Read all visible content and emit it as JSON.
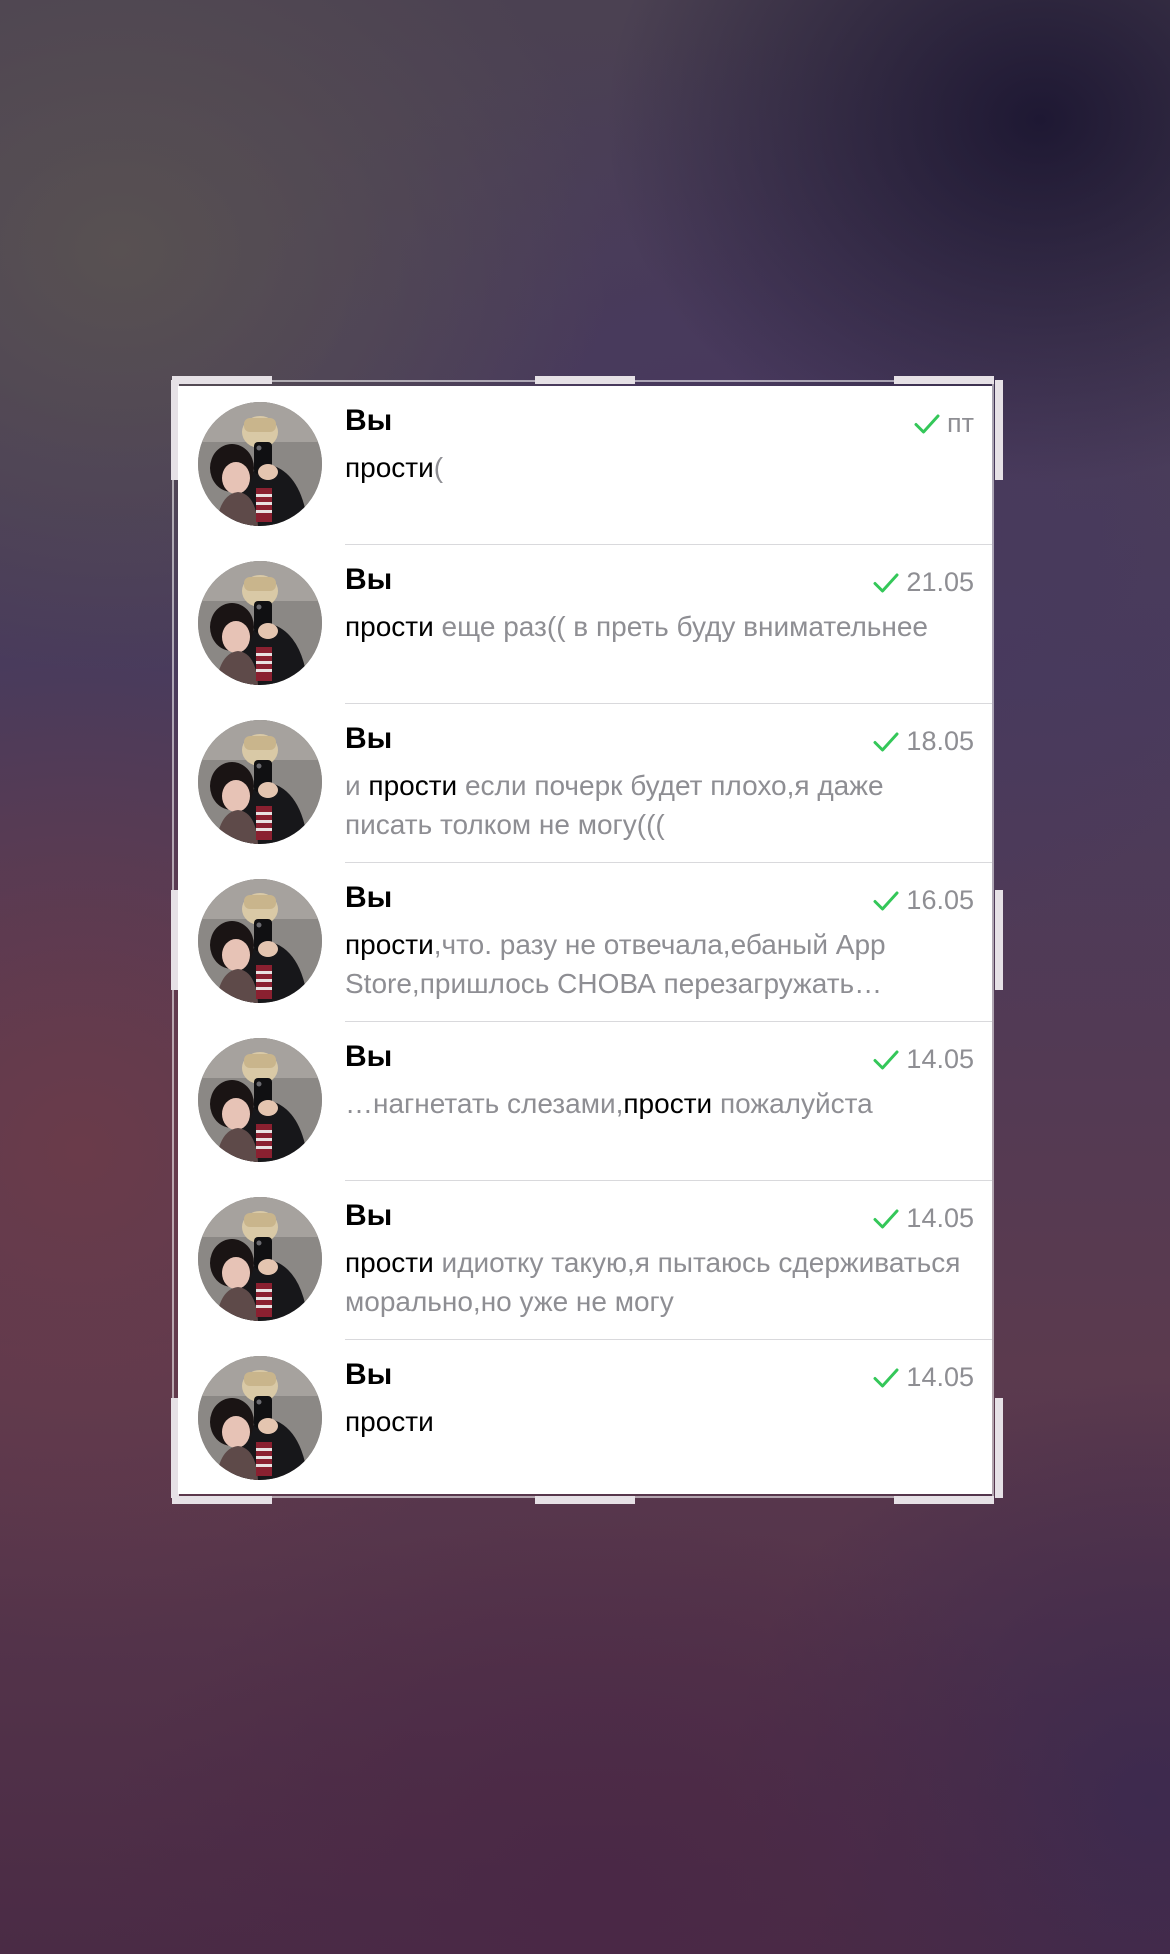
{
  "colors": {
    "check_green": "#34c759",
    "secondary_text": "#8e8e93",
    "primary_text": "#000000"
  },
  "icons": {
    "read_status": "check-icon",
    "avatar": "avatar-photo"
  },
  "chats": [
    {
      "sender": "Вы",
      "date": "пт",
      "preview": [
        {
          "text": "прости",
          "highlight": true
        },
        {
          "text": "(",
          "highlight": false
        }
      ]
    },
    {
      "sender": "Вы",
      "date": "21.05",
      "preview": [
        {
          "text": "прости",
          "highlight": true
        },
        {
          "text": " еще раз(( в преть буду внимательнее",
          "highlight": false
        }
      ]
    },
    {
      "sender": "Вы",
      "date": "18.05",
      "preview": [
        {
          "text": "и ",
          "highlight": false
        },
        {
          "text": "прости",
          "highlight": true
        },
        {
          "text": " если почерк будет плохо,я даже писать толком не могу(((",
          "highlight": false
        }
      ]
    },
    {
      "sender": "Вы",
      "date": "16.05",
      "preview": [
        {
          "text": "прости",
          "highlight": true
        },
        {
          "text": ",что. разу не отвечала,ебаный App Store,пришлось СНОВА перезагружать…",
          "highlight": false
        }
      ]
    },
    {
      "sender": "Вы",
      "date": "14.05",
      "preview": [
        {
          "text": "…нагнетать слезами,",
          "highlight": false
        },
        {
          "text": "прости",
          "highlight": true
        },
        {
          "text": " пожалуйста",
          "highlight": false
        }
      ]
    },
    {
      "sender": "Вы",
      "date": "14.05",
      "preview": [
        {
          "text": "прости",
          "highlight": true
        },
        {
          "text": " идиотку такую,я пытаюсь сдерживаться морально,но уже не могу",
          "highlight": false
        }
      ]
    },
    {
      "sender": "Вы",
      "date": "14.05",
      "preview": [
        {
          "text": "прости",
          "highlight": true
        }
      ]
    }
  ]
}
